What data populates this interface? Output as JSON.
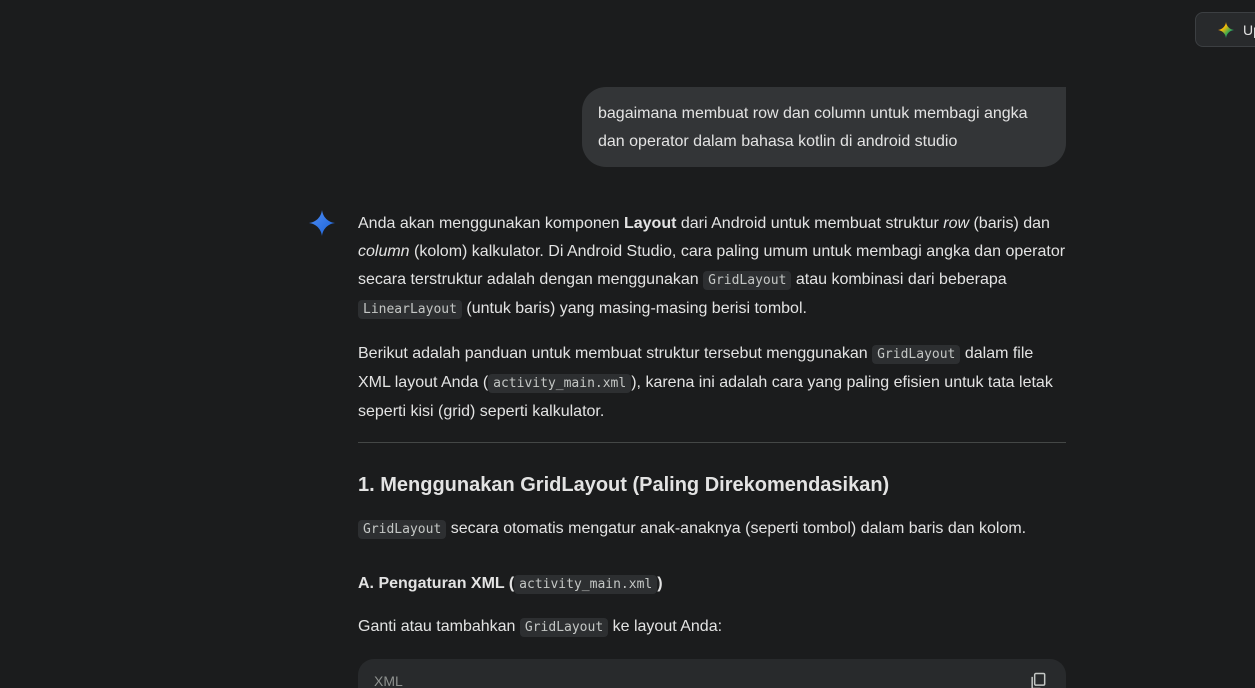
{
  "header": {
    "upgrade_label": "Up"
  },
  "user_message": {
    "text": "bagaimana membuat row dan column untuk membagi angka dan operator dalam bahasa kotlin di android studio"
  },
  "response": {
    "p1": {
      "t1": "Anda akan menggunakan komponen ",
      "b1": "Layout",
      "t2": " dari Android untuk membuat struktur ",
      "i1": "row",
      "t3": " (baris) dan ",
      "i2": "column",
      "t4": " (kolom) kalkulator. Di Android Studio, cara paling umum untuk membagi angka dan operator secara terstruktur adalah dengan menggunakan ",
      "c1": "GridLayout",
      "t5": " atau kombinasi dari beberapa ",
      "c2": "LinearLayout",
      "t6": " (untuk baris) yang masing-masing berisi tombol."
    },
    "p2": {
      "t1": "Berikut adalah panduan untuk membuat struktur tersebut menggunakan ",
      "c1": "GridLayout",
      "t2": " dalam file XML layout Anda (",
      "c2": "activity_main.xml",
      "t3": "), karena ini adalah cara yang paling efisien untuk tata letak seperti kisi (grid) seperti kalkulator."
    },
    "heading1": "1. Menggunakan GridLayout (Paling Direkomendasikan)",
    "p3": {
      "c1": "GridLayout",
      "t1": " secara otomatis mengatur anak-anaknya (seperti tombol) dalam baris dan kolom."
    },
    "heading2": {
      "t1": "A. Pengaturan XML (",
      "c1": "activity_main.xml",
      "t2": ")"
    },
    "p4": {
      "t1": "Ganti atau tambahkan ",
      "c1": "GridLayout",
      "t2": " ke layout Anda:"
    },
    "code_block": {
      "language": "XML",
      "copy_icon": "copy-icon"
    }
  }
}
